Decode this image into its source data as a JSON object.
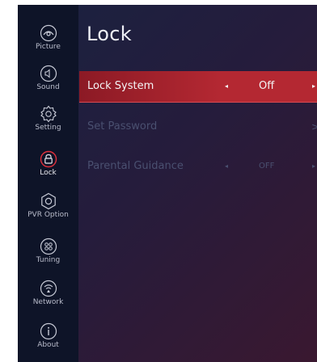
{
  "page": {
    "title": "Lock"
  },
  "sidebar": {
    "items": [
      {
        "label": "Picture",
        "icon": "picture-icon"
      },
      {
        "label": "Sound",
        "icon": "speaker-icon"
      },
      {
        "label": "Setting",
        "icon": "gear-icon"
      },
      {
        "label": "Lock",
        "icon": "lock-icon",
        "active": true
      },
      {
        "label": "PVR Option",
        "icon": "pvr-icon"
      },
      {
        "label": "Tuning",
        "icon": "tuning-icon"
      },
      {
        "label": "Network",
        "icon": "network-icon"
      },
      {
        "label": "About",
        "icon": "info-icon"
      }
    ]
  },
  "menu": {
    "rows": [
      {
        "label": "Lock System",
        "left_arrow": "◂",
        "value": "Off",
        "right_arrow": "▸"
      },
      {
        "label": "Set Password",
        "chevron": ">"
      },
      {
        "label": "Parental Guidance",
        "left_arrow": "◂",
        "value": "OFF",
        "right_arrow": "▸"
      }
    ]
  },
  "colors": {
    "selection": "#b42832",
    "sidebar_bg": "#0e1428",
    "active_icon": "#e0303c",
    "disabled_text": "#4a5070"
  }
}
